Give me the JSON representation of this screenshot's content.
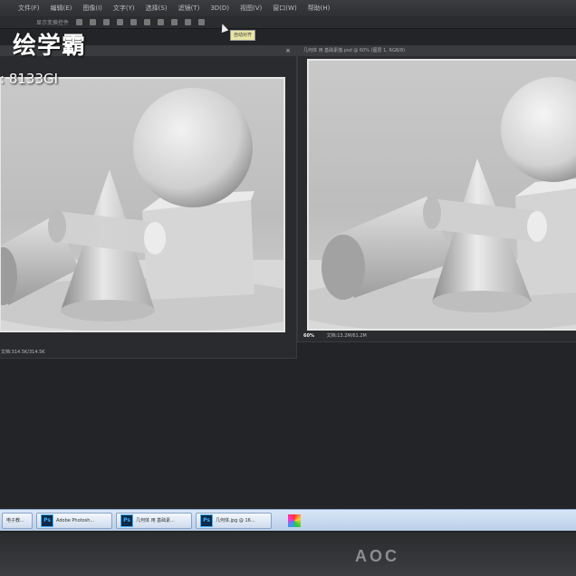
{
  "watermark": {
    "title": "绘学霸",
    "id": ": 8133GI"
  },
  "menu": {
    "items": [
      "文件(F)",
      "编辑(E)",
      "图像(I)",
      "文字(Y)",
      "选择(S)",
      "滤镜(T)",
      "3D(D)",
      "视图(V)",
      "窗口(W)",
      "帮助(H)"
    ]
  },
  "options": {
    "label": "显示变换控件"
  },
  "tooltip": {
    "text": "自动对齐"
  },
  "doc_right": {
    "title": "几何体 用 基础素描.psd @ 60% (图层 1, RGB/8)"
  },
  "status_left": {
    "doc": "文档:314.5K/314.5K"
  },
  "status_right": {
    "zoom": "60%",
    "doc": "文档:13.2M/61.2M"
  },
  "taskbar": {
    "items": [
      {
        "label": "电子教...",
        "icon": ""
      },
      {
        "label": "Adobe Photosh...",
        "icon": "Ps"
      },
      {
        "label": "几何体 用 基础素...",
        "icon": "Ps"
      },
      {
        "label": "几何体.jpg @ 16...",
        "icon": "Ps"
      }
    ]
  },
  "monitor": {
    "brand": "AOC"
  },
  "colors": {
    "ps_blue": "#3fb0ff",
    "taskbar": "#c9dbef",
    "bg": "#232427"
  }
}
